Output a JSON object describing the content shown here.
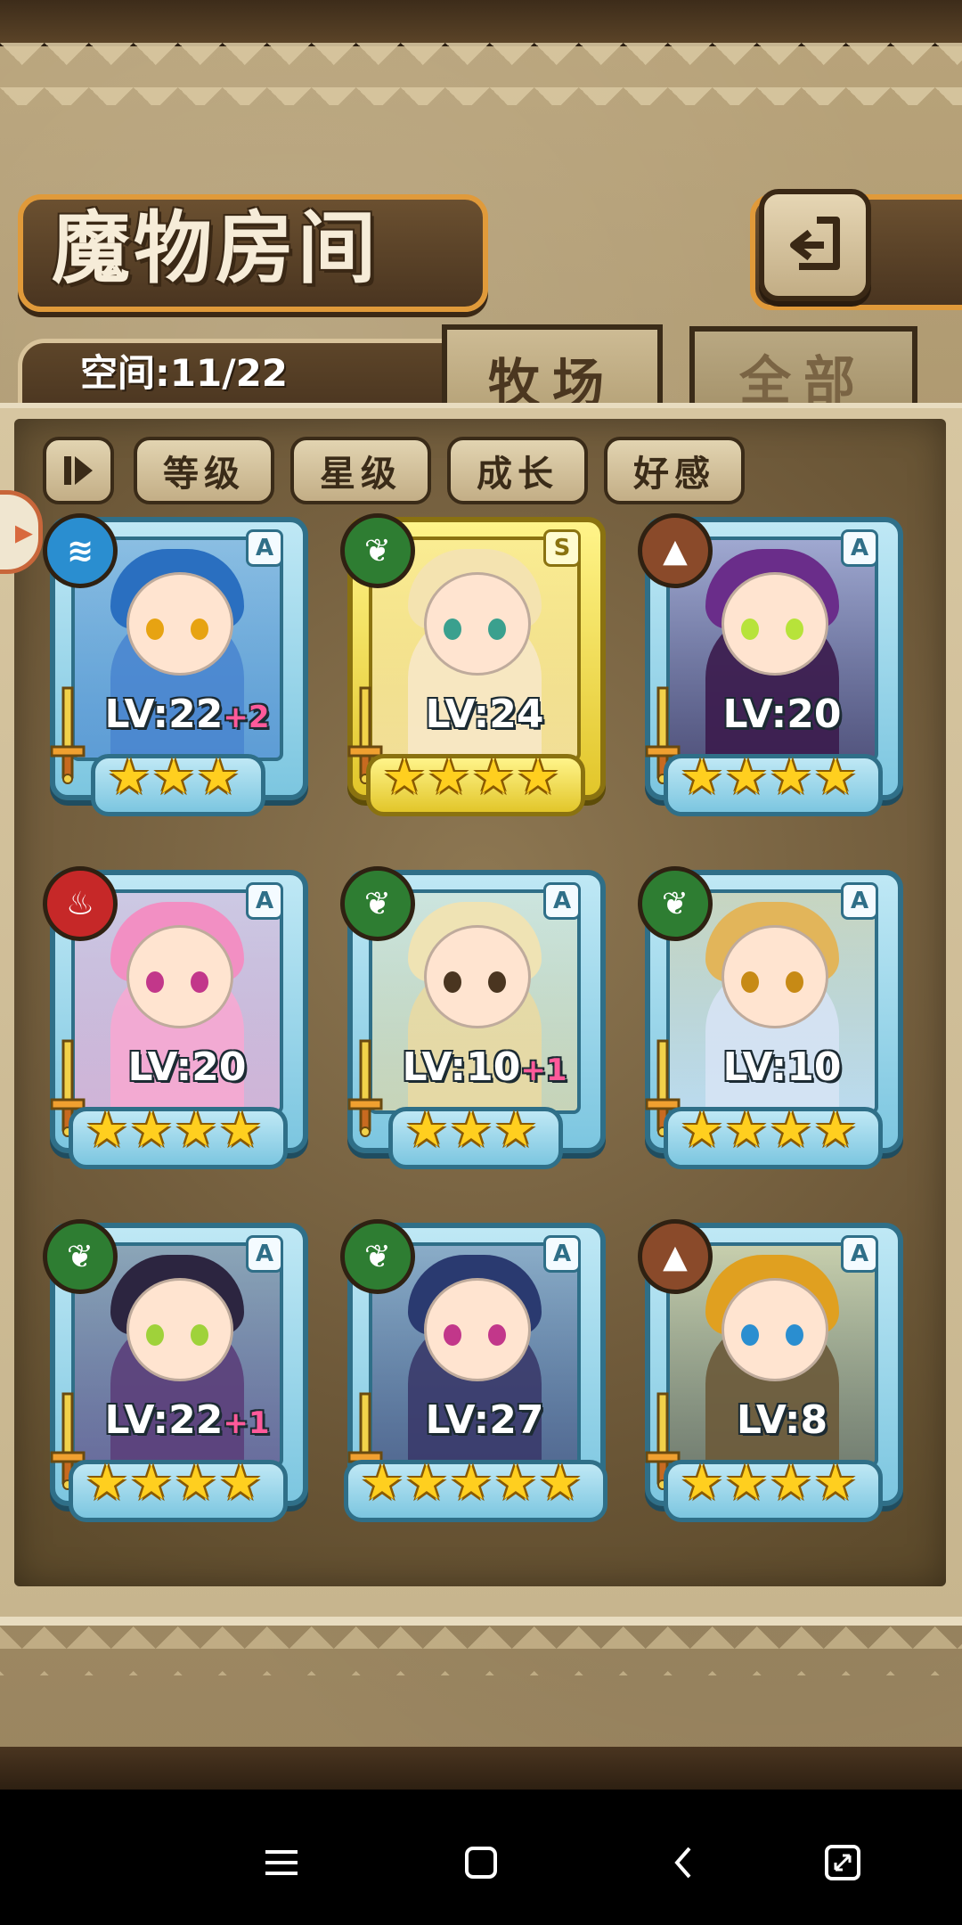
{
  "title": "魔物房间",
  "space_label": "空间:11/22",
  "tabs": [
    {
      "label": "牧场",
      "active": true
    },
    {
      "label": "全部",
      "active": false
    }
  ],
  "sort_buttons": [
    "等级",
    "星级",
    "成长",
    "好感"
  ],
  "colors": {
    "accent_orange": "#e09a3a",
    "card_blue": "#7cc6e0",
    "card_gold": "#e2c62a",
    "bonus_pink": "#ff5a9a",
    "element_water": "#2a8ed0",
    "element_nature": "#2e7d32",
    "element_earth": "#8a4a2a",
    "element_fire": "#c62828"
  },
  "monsters": [
    {
      "level": "LV:22",
      "bonus": "+2",
      "stars": "★★★",
      "rank": "A",
      "element": "water-icon",
      "element_glyph": "≋",
      "gold": false,
      "hair": "#2a6fc0",
      "body": "#4a86cf",
      "eyes": "#e7a312"
    },
    {
      "level": "LV:24",
      "bonus": "",
      "stars": "★★★★",
      "rank": "S",
      "element": "leaf-icon",
      "element_glyph": "❦",
      "gold": true,
      "hair": "#f4e3b0",
      "body": "#f7e8c7",
      "eyes": "#3aa08e"
    },
    {
      "level": "LV:20",
      "bonus": "",
      "stars": "★★★★",
      "rank": "A",
      "element": "mountain-icon",
      "element_glyph": "▲",
      "gold": false,
      "hair": "#6a2d8a",
      "body": "#3b1b4d",
      "eyes": "#b7e33a"
    },
    {
      "level": "LV:20",
      "bonus": "",
      "stars": "★★★★",
      "rank": "A",
      "element": "fire-icon",
      "element_glyph": "♨",
      "gold": false,
      "hair": "#f28fc3",
      "body": "#f6a9d2",
      "eyes": "#c2378a"
    },
    {
      "level": "LV:10",
      "bonus": "+1",
      "stars": "★★★",
      "rank": "A",
      "element": "leaf-icon",
      "element_glyph": "❦",
      "gold": false,
      "hair": "#efe3b4",
      "body": "#e8d9a3",
      "eyes": "#4a3520"
    },
    {
      "level": "LV:10",
      "bonus": "",
      "stars": "★★★★",
      "rank": "A",
      "element": "leaf-icon",
      "element_glyph": "❦",
      "gold": false,
      "hair": "#e2b55a",
      "body": "#d6e3f4",
      "eyes": "#c78a15"
    },
    {
      "level": "LV:22",
      "bonus": "+1",
      "stars": "★★★★",
      "rank": "A",
      "element": "leaf-icon",
      "element_glyph": "❦",
      "gold": false,
      "hair": "#2c2540",
      "body": "#5b3f7a",
      "eyes": "#9fd23a"
    },
    {
      "level": "LV:27",
      "bonus": "",
      "stars": "★★★★★",
      "rank": "A",
      "element": "leaf-icon",
      "element_glyph": "❦",
      "gold": false,
      "hair": "#2a3a70",
      "body": "#3a3a6a",
      "eyes": "#c2378a"
    },
    {
      "level": "LV:8",
      "bonus": "",
      "stars": "★★★★",
      "rank": "A",
      "element": "mountain-icon",
      "element_glyph": "▲",
      "gold": false,
      "hair": "#e0a020",
      "body": "#6c5a3a",
      "eyes": "#2a8ed0"
    }
  ]
}
